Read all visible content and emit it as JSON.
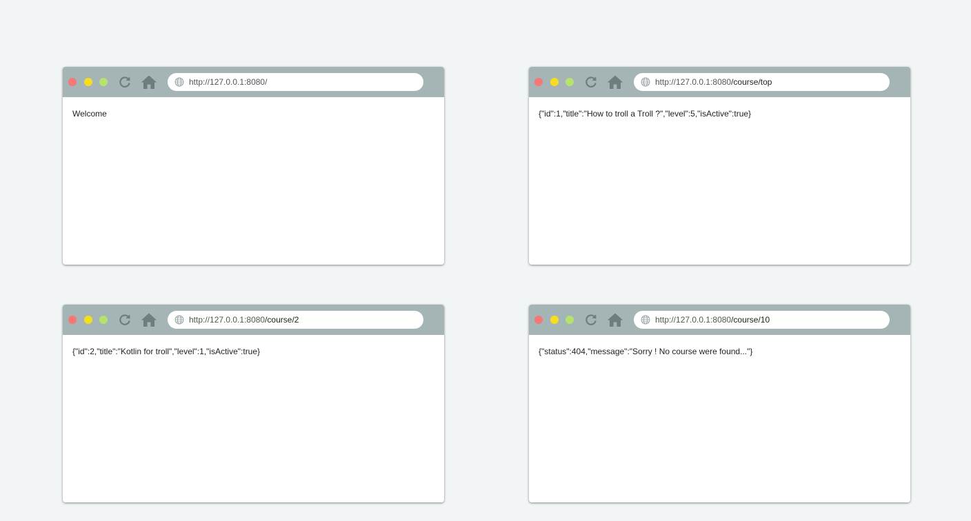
{
  "windows": [
    {
      "url_base": "http://127.0.0.1:8080/",
      "url_path": "",
      "content": "Welcome"
    },
    {
      "url_base": "http://127.0.0.1:8080",
      "url_path": "/course/top",
      "content": "{\"id\":1,\"title\":\"How to troll a Troll ?\",\"level\":5,\"isActive\":true}"
    },
    {
      "url_base": "http://127.0.0.1:8080",
      "url_path": "/course/2",
      "content": "{\"id\":2,\"title\":\"Kotlin for troll\",\"level\":1,\"isActive\":true}"
    },
    {
      "url_base": "http://127.0.0.1:8080",
      "url_path": "/course/10",
      "content": "{\"status\":404,\"message\":\"Sorry ! No course were found...\"}"
    }
  ],
  "icons": {
    "reload": "reload-icon",
    "home": "home-icon",
    "globe": "globe-icon"
  },
  "colors": {
    "page_background": "#f2f5f6",
    "toolbar": "#a5b5b6",
    "icon": "#6e7e7f",
    "close_dot": "#f77676",
    "minimize_dot": "#f7dd1e",
    "maximize_dot": "#b5e36d"
  }
}
